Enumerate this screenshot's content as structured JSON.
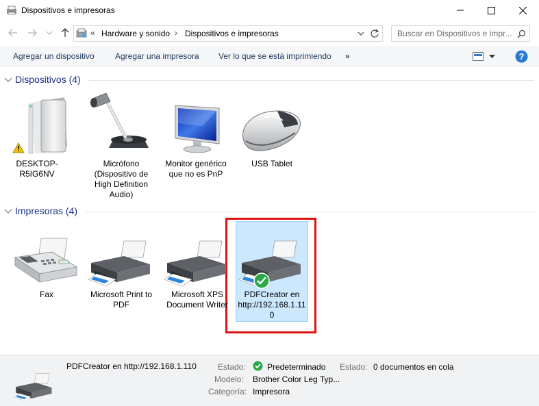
{
  "window": {
    "title": "Dispositivos e impresoras"
  },
  "address": {
    "crumbs": [
      "Hardware y sonido",
      "Dispositivos e impresoras"
    ],
    "search_placeholder": "Buscar en Dispositivos e impr..."
  },
  "commands": {
    "add_device": "Agregar un dispositivo",
    "add_printer": "Agregar una impresora",
    "see_printing": "Ver lo que se está imprimiendo",
    "more": "»"
  },
  "devices": {
    "header": "Dispositivos (4)",
    "items": [
      {
        "label": "DESKTOP-R5IG6NV",
        "icon": "computer-tower-warning-icon"
      },
      {
        "label": "Micrófono (Dispositivo de High Definition Audio)",
        "icon": "microphone-icon"
      },
      {
        "label": "Monitor genérico que no es PnP",
        "icon": "monitor-icon"
      },
      {
        "label": "USB Tablet",
        "icon": "mouse-icon"
      }
    ]
  },
  "printers": {
    "header": "Impresoras (4)",
    "items": [
      {
        "label": "Fax",
        "icon": "fax-icon"
      },
      {
        "label": "Microsoft Print to PDF",
        "icon": "printer-icon"
      },
      {
        "label": "Microsoft XPS Document Writer",
        "icon": "printer-icon"
      },
      {
        "label": "PDFCreator en http://192.168.1.110",
        "icon": "printer-default-icon",
        "selected": true
      }
    ]
  },
  "details": {
    "name": "PDFCreator en http://192.168.1.110",
    "estado_label": "Estado:",
    "estado_value": "Predeterminado",
    "estado2_label": "Estado:",
    "estado2_value": "0 documentos en cola",
    "modelo_label": "Modelo:",
    "modelo_value": "Brother Color Leg Typ...",
    "categoria_label": "Categoría:",
    "categoria_value": "Impresora"
  },
  "colors": {
    "link_text": "#1e395b",
    "section_header": "#1e3287",
    "selection_fill": "#cce8ff",
    "highlight_border": "#e01010",
    "help_button": "#2a7ad5",
    "default_check": "#2aa84a"
  }
}
